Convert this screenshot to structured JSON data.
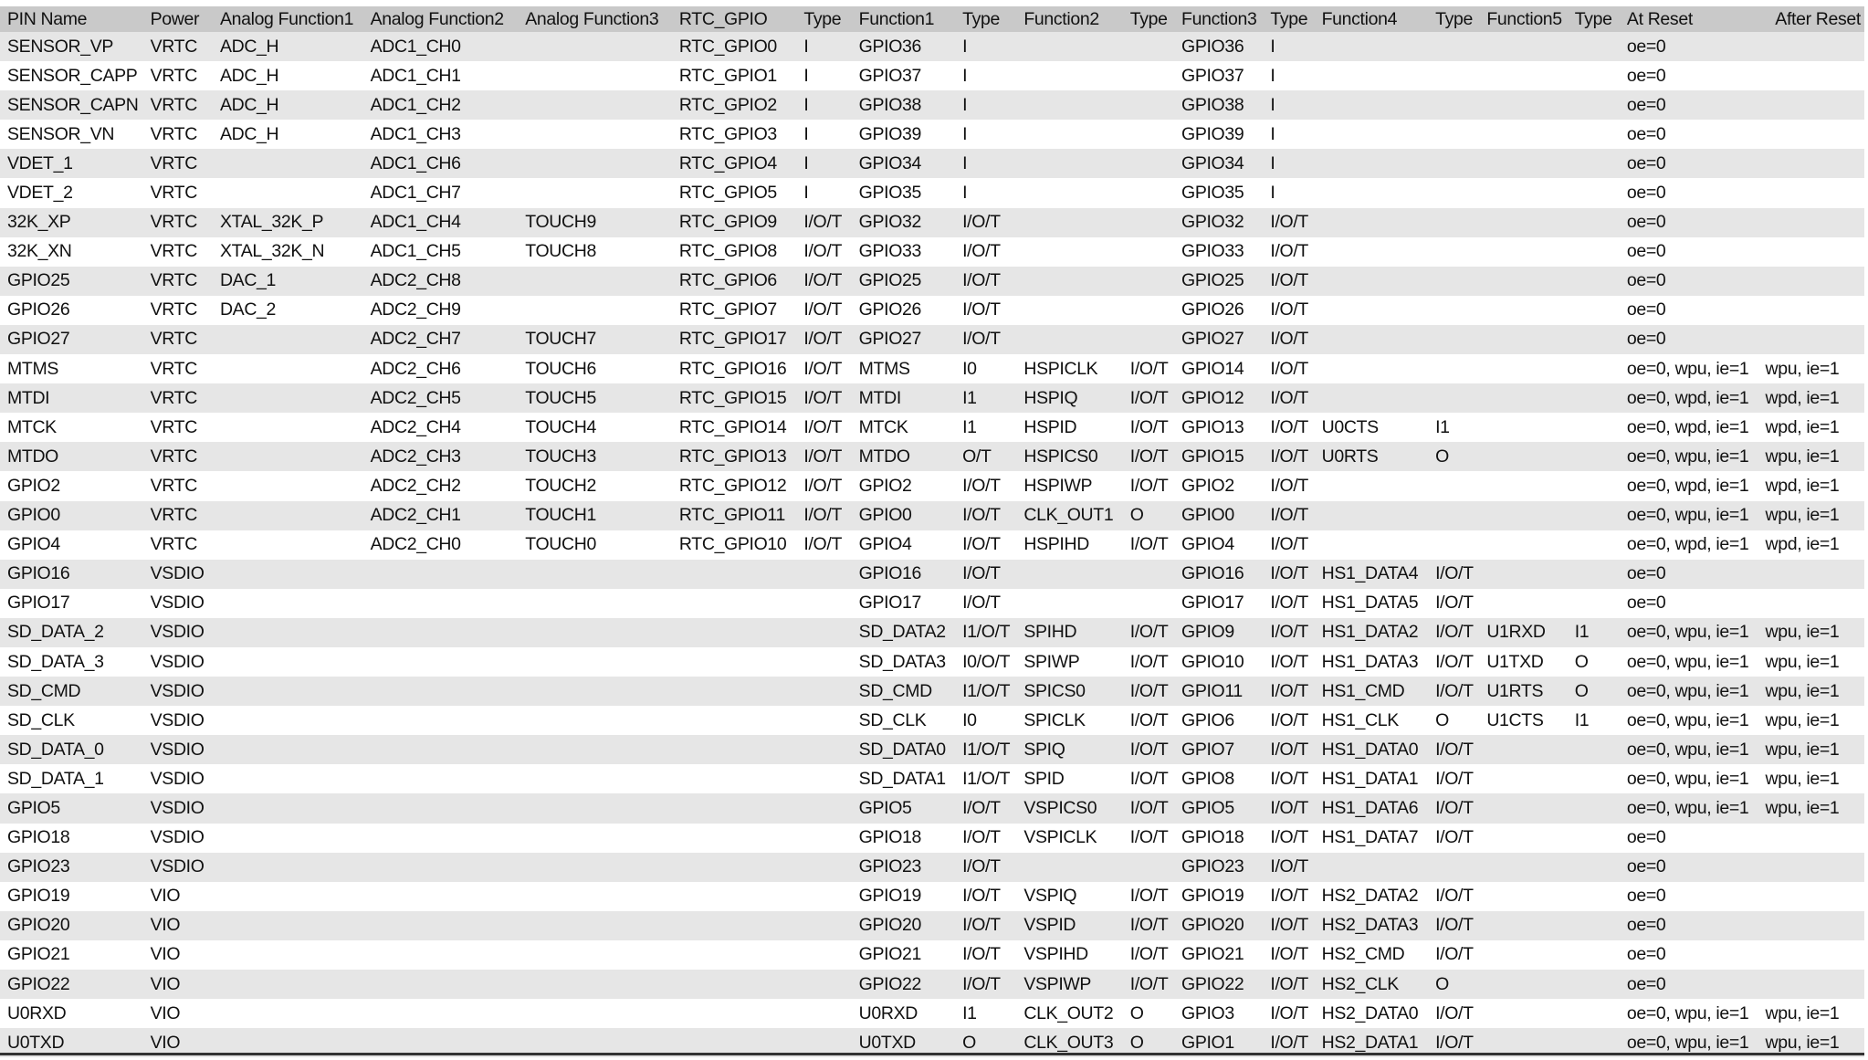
{
  "table": {
    "headers": [
      "PIN Name",
      "Power",
      "Analog Function1",
      "Analog Function2",
      "Analog Function3",
      "RTC_GPIO",
      "Type",
      "Function1",
      "Type",
      "Function2",
      "Type",
      "Function3",
      "Type",
      "Function4",
      "Type",
      "Function5",
      "Type",
      "At Reset",
      "After Reset"
    ],
    "rows": [
      [
        "SENSOR_VP",
        "VRTC",
        "ADC_H",
        "ADC1_CH0",
        "",
        "RTC_GPIO0",
        "I",
        "GPIO36",
        "I",
        "",
        "",
        "GPIO36",
        "I",
        "",
        "",
        "",
        "",
        "oe=0",
        ""
      ],
      [
        "SENSOR_CAPP",
        "VRTC",
        "ADC_H",
        "ADC1_CH1",
        "",
        "RTC_GPIO1",
        "I",
        "GPIO37",
        "I",
        "",
        "",
        "GPIO37",
        "I",
        "",
        "",
        "",
        "",
        "oe=0",
        ""
      ],
      [
        "SENSOR_CAPN",
        "VRTC",
        "ADC_H",
        "ADC1_CH2",
        "",
        "RTC_GPIO2",
        "I",
        "GPIO38",
        "I",
        "",
        "",
        "GPIO38",
        "I",
        "",
        "",
        "",
        "",
        "oe=0",
        ""
      ],
      [
        "SENSOR_VN",
        "VRTC",
        "ADC_H",
        "ADC1_CH3",
        "",
        "RTC_GPIO3",
        "I",
        "GPIO39",
        "I",
        "",
        "",
        "GPIO39",
        "I",
        "",
        "",
        "",
        "",
        "oe=0",
        ""
      ],
      [
        "VDET_1",
        "VRTC",
        "",
        "ADC1_CH6",
        "",
        "RTC_GPIO4",
        "I",
        "GPIO34",
        "I",
        "",
        "",
        "GPIO34",
        "I",
        "",
        "",
        "",
        "",
        "oe=0",
        ""
      ],
      [
        "VDET_2",
        "VRTC",
        "",
        "ADC1_CH7",
        "",
        "RTC_GPIO5",
        "I",
        "GPIO35",
        "I",
        "",
        "",
        "GPIO35",
        "I",
        "",
        "",
        "",
        "",
        "oe=0",
        ""
      ],
      [
        "32K_XP",
        "VRTC",
        "XTAL_32K_P",
        "ADC1_CH4",
        "TOUCH9",
        "RTC_GPIO9",
        "I/O/T",
        "GPIO32",
        "I/O/T",
        "",
        "",
        "GPIO32",
        "I/O/T",
        "",
        "",
        "",
        "",
        "oe=0",
        ""
      ],
      [
        "32K_XN",
        "VRTC",
        "XTAL_32K_N",
        "ADC1_CH5",
        "TOUCH8",
        "RTC_GPIO8",
        "I/O/T",
        "GPIO33",
        "I/O/T",
        "",
        "",
        "GPIO33",
        "I/O/T",
        "",
        "",
        "",
        "",
        "oe=0",
        ""
      ],
      [
        "GPIO25",
        "VRTC",
        "DAC_1",
        "ADC2_CH8",
        "",
        "RTC_GPIO6",
        "I/O/T",
        "GPIO25",
        "I/O/T",
        "",
        "",
        "GPIO25",
        "I/O/T",
        "",
        "",
        "",
        "",
        "oe=0",
        ""
      ],
      [
        "GPIO26",
        "VRTC",
        "DAC_2",
        "ADC2_CH9",
        "",
        "RTC_GPIO7",
        "I/O/T",
        "GPIO26",
        "I/O/T",
        "",
        "",
        "GPIO26",
        "I/O/T",
        "",
        "",
        "",
        "",
        "oe=0",
        ""
      ],
      [
        "GPIO27",
        "VRTC",
        "",
        "ADC2_CH7",
        "TOUCH7",
        "RTC_GPIO17",
        "I/O/T",
        "GPIO27",
        "I/O/T",
        "",
        "",
        "GPIO27",
        "I/O/T",
        "",
        "",
        "",
        "",
        "oe=0",
        ""
      ],
      [
        "MTMS",
        "VRTC",
        "",
        "ADC2_CH6",
        "TOUCH6",
        "RTC_GPIO16",
        "I/O/T",
        "MTMS",
        "I0",
        "HSPICLK",
        "I/O/T",
        "GPIO14",
        "I/O/T",
        "",
        "",
        "",
        "",
        "oe=0, wpu, ie=1",
        "wpu, ie=1"
      ],
      [
        "MTDI",
        "VRTC",
        "",
        "ADC2_CH5",
        "TOUCH5",
        "RTC_GPIO15",
        "I/O/T",
        "MTDI",
        "I1",
        "HSPIQ",
        "I/O/T",
        "GPIO12",
        "I/O/T",
        "",
        "",
        "",
        "",
        "oe=0, wpd, ie=1",
        "wpd, ie=1"
      ],
      [
        "MTCK",
        "VRTC",
        "",
        "ADC2_CH4",
        "TOUCH4",
        "RTC_GPIO14",
        "I/O/T",
        "MTCK",
        "I1",
        "HSPID",
        "I/O/T",
        "GPIO13",
        "I/O/T",
        "U0CTS",
        "I1",
        "",
        "",
        "oe=0, wpd, ie=1",
        "wpd, ie=1"
      ],
      [
        "MTDO",
        "VRTC",
        "",
        "ADC2_CH3",
        "TOUCH3",
        "RTC_GPIO13",
        "I/O/T",
        "MTDO",
        "O/T",
        "HSPICS0",
        "I/O/T",
        "GPIO15",
        "I/O/T",
        "U0RTS",
        "O",
        "",
        "",
        "oe=0, wpu, ie=1",
        "wpu, ie=1"
      ],
      [
        "GPIO2",
        "VRTC",
        "",
        "ADC2_CH2",
        "TOUCH2",
        "RTC_GPIO12",
        "I/O/T",
        "GPIO2",
        "I/O/T",
        "HSPIWP",
        "I/O/T",
        "GPIO2",
        "I/O/T",
        "",
        "",
        "",
        "",
        "oe=0, wpd, ie=1",
        "wpd, ie=1"
      ],
      [
        "GPIO0",
        "VRTC",
        "",
        "ADC2_CH1",
        "TOUCH1",
        "RTC_GPIO11",
        "I/O/T",
        "GPIO0",
        "I/O/T",
        "CLK_OUT1",
        "O",
        "GPIO0",
        "I/O/T",
        "",
        "",
        "",
        "",
        "oe=0, wpu, ie=1",
        "wpu, ie=1"
      ],
      [
        "GPIO4",
        "VRTC",
        "",
        "ADC2_CH0",
        "TOUCH0",
        "RTC_GPIO10",
        "I/O/T",
        "GPIO4",
        "I/O/T",
        "HSPIHD",
        "I/O/T",
        "GPIO4",
        "I/O/T",
        "",
        "",
        "",
        "",
        "oe=0, wpd, ie=1",
        "wpd, ie=1"
      ],
      [
        "GPIO16",
        "VSDIO",
        "",
        "",
        "",
        "",
        "",
        "GPIO16",
        "I/O/T",
        "",
        "",
        "GPIO16",
        "I/O/T",
        "HS1_DATA4",
        "I/O/T",
        "",
        "",
        "oe=0",
        ""
      ],
      [
        "GPIO17",
        "VSDIO",
        "",
        "",
        "",
        "",
        "",
        "GPIO17",
        "I/O/T",
        "",
        "",
        "GPIO17",
        "I/O/T",
        "HS1_DATA5",
        "I/O/T",
        "",
        "",
        "oe=0",
        ""
      ],
      [
        "SD_DATA_2",
        "VSDIO",
        "",
        "",
        "",
        "",
        "",
        "SD_DATA2",
        "I1/O/T",
        "SPIHD",
        "I/O/T",
        "GPIO9",
        "I/O/T",
        "HS1_DATA2",
        "I/O/T",
        "U1RXD",
        "I1",
        "oe=0, wpu, ie=1",
        "wpu, ie=1"
      ],
      [
        "SD_DATA_3",
        "VSDIO",
        "",
        "",
        "",
        "",
        "",
        "SD_DATA3",
        "I0/O/T",
        "SPIWP",
        "I/O/T",
        "GPIO10",
        "I/O/T",
        "HS1_DATA3",
        "I/O/T",
        "U1TXD",
        "O",
        "oe=0, wpu, ie=1",
        "wpu, ie=1"
      ],
      [
        "SD_CMD",
        "VSDIO",
        "",
        "",
        "",
        "",
        "",
        "SD_CMD",
        "I1/O/T",
        "SPICS0",
        "I/O/T",
        "GPIO11",
        "I/O/T",
        "HS1_CMD",
        "I/O/T",
        "U1RTS",
        "O",
        "oe=0, wpu, ie=1",
        "wpu, ie=1"
      ],
      [
        "SD_CLK",
        "VSDIO",
        "",
        "",
        "",
        "",
        "",
        "SD_CLK",
        "I0",
        "SPICLK",
        "I/O/T",
        "GPIO6",
        "I/O/T",
        "HS1_CLK",
        "O",
        "U1CTS",
        "I1",
        "oe=0, wpu, ie=1",
        "wpu, ie=1"
      ],
      [
        "SD_DATA_0",
        "VSDIO",
        "",
        "",
        "",
        "",
        "",
        "SD_DATA0",
        "I1/O/T",
        "SPIQ",
        "I/O/T",
        "GPIO7",
        "I/O/T",
        "HS1_DATA0",
        "I/O/T",
        "",
        "",
        "oe=0, wpu, ie=1",
        "wpu, ie=1"
      ],
      [
        "SD_DATA_1",
        "VSDIO",
        "",
        "",
        "",
        "",
        "",
        "SD_DATA1",
        "I1/O/T",
        "SPID",
        "I/O/T",
        "GPIO8",
        "I/O/T",
        "HS1_DATA1",
        "I/O/T",
        "",
        "",
        "oe=0, wpu, ie=1",
        "wpu, ie=1"
      ],
      [
        "GPIO5",
        "VSDIO",
        "",
        "",
        "",
        "",
        "",
        "GPIO5",
        "I/O/T",
        "VSPICS0",
        "I/O/T",
        "GPIO5",
        "I/O/T",
        "HS1_DATA6",
        "I/O/T",
        "",
        "",
        "oe=0, wpu, ie=1",
        "wpu, ie=1"
      ],
      [
        "GPIO18",
        "VSDIO",
        "",
        "",
        "",
        "",
        "",
        "GPIO18",
        "I/O/T",
        "VSPICLK",
        "I/O/T",
        "GPIO18",
        "I/O/T",
        "HS1_DATA7",
        "I/O/T",
        "",
        "",
        "oe=0",
        ""
      ],
      [
        "GPIO23",
        "VSDIO",
        "",
        "",
        "",
        "",
        "",
        "GPIO23",
        "I/O/T",
        "",
        "",
        "GPIO23",
        "I/O/T",
        "",
        "",
        "",
        "",
        "oe=0",
        ""
      ],
      [
        "GPIO19",
        "VIO",
        "",
        "",
        "",
        "",
        "",
        "GPIO19",
        "I/O/T",
        "VSPIQ",
        "I/O/T",
        "GPIO19",
        "I/O/T",
        "HS2_DATA2",
        "I/O/T",
        "",
        "",
        "oe=0",
        ""
      ],
      [
        "GPIO20",
        "VIO",
        "",
        "",
        "",
        "",
        "",
        "GPIO20",
        "I/O/T",
        "VSPID",
        "I/O/T",
        "GPIO20",
        "I/O/T",
        "HS2_DATA3",
        "I/O/T",
        "",
        "",
        "oe=0",
        ""
      ],
      [
        "GPIO21",
        "VIO",
        "",
        "",
        "",
        "",
        "",
        "GPIO21",
        "I/O/T",
        "VSPIHD",
        "I/O/T",
        "GPIO21",
        "I/O/T",
        "HS2_CMD",
        "I/O/T",
        "",
        "",
        "oe=0",
        ""
      ],
      [
        "GPIO22",
        "VIO",
        "",
        "",
        "",
        "",
        "",
        "GPIO22",
        "I/O/T",
        "VSPIWP",
        "I/O/T",
        "GPIO22",
        "I/O/T",
        "HS2_CLK",
        "O",
        "",
        "",
        "oe=0",
        ""
      ],
      [
        "U0RXD",
        "VIO",
        "",
        "",
        "",
        "",
        "",
        "U0RXD",
        "I1",
        "CLK_OUT2",
        "O",
        "GPIO3",
        "I/O/T",
        "HS2_DATA0",
        "I/O/T",
        "",
        "",
        "oe=0, wpu, ie=1",
        "wpu, ie=1"
      ],
      [
        "U0TXD",
        "VIO",
        "",
        "",
        "",
        "",
        "",
        "U0TXD",
        "O",
        "CLK_OUT3",
        "O",
        "GPIO1",
        "I/O/T",
        "HS2_DATA1",
        "I/O/T",
        "",
        "",
        "oe=0, wpu, ie=1",
        "wpu, ie=1"
      ]
    ]
  },
  "colors": {
    "header_bg": "#c9c9c9",
    "stripe_bg": "#e6e6e6",
    "rule": "#333333"
  }
}
